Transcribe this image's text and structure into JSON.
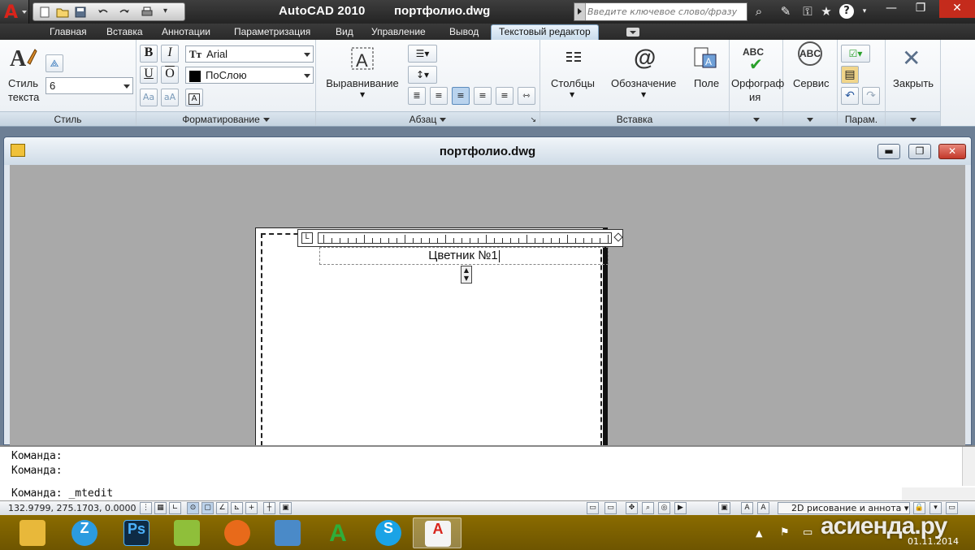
{
  "title": {
    "app": "AutoCAD 2010",
    "file": "портфолио.dwg"
  },
  "search": {
    "placeholder": "Введите ключевое слово/фразу"
  },
  "tabs": [
    {
      "label": "Главная"
    },
    {
      "label": "Вставка"
    },
    {
      "label": "Аннотации"
    },
    {
      "label": "Параметризация"
    },
    {
      "label": "Вид"
    },
    {
      "label": "Управление"
    },
    {
      "label": "Вывод"
    },
    {
      "label": "Текстовый редактор"
    }
  ],
  "ribbon": {
    "style": {
      "title": "Стиль",
      "button_label_1": "Стиль",
      "button_label_2": "текста",
      "height_value": "6"
    },
    "format": {
      "title": "Форматирование",
      "bold": "B",
      "italic": "I",
      "underline": "U",
      "overline": "O",
      "font_value": "Arial",
      "color_value": "ПоСлою",
      "case_upper": "Aa",
      "case_lower": "aA"
    },
    "paragraph": {
      "title": "Абзац",
      "justify_label": "Выравнивание"
    },
    "insert": {
      "title": "Вставка",
      "columns": "Столбцы",
      "symbol": "Обозначение",
      "field": "Поле"
    },
    "spell": {
      "label_1": "Орфограф",
      "label_2": "ия",
      "icon_text": "ABC"
    },
    "tools": {
      "label": "Сервис",
      "icon_text": "ABC"
    },
    "options": {
      "title": "Парам."
    },
    "close": {
      "label": "Закрыть"
    }
  },
  "document": {
    "title": "портфолио.dwg",
    "text": "Цветник №1"
  },
  "command": {
    "line1": "Команда:",
    "line2": "Команда:",
    "prompt": "Команда:  _mtedit"
  },
  "status": {
    "coords": "132.9799, 275.1703, 0.0000",
    "workspace": "2D рисование и аннота"
  },
  "taskbar": {
    "apps": [
      {
        "icon": "folder-icon",
        "color": "#e8b83a"
      },
      {
        "icon": "zoho-icon",
        "color": "#2b9be0",
        "text": "Z"
      },
      {
        "icon": "photoshop-icon",
        "color": "#0e2b45",
        "text": "Ps"
      },
      {
        "icon": "notepad-icon",
        "color": "#8fbf3a"
      },
      {
        "icon": "firefox-icon",
        "color": "#e86a1a"
      },
      {
        "icon": "image-viewer-icon",
        "color": "#4a8ac8"
      },
      {
        "icon": "app-a-icon",
        "color": "#2fae3a",
        "text": "A"
      },
      {
        "icon": "skype-icon",
        "color": "#1aa3e6",
        "text": "S"
      },
      {
        "icon": "autocad-icon",
        "color": "#d8241b"
      }
    ],
    "watermark": "асиенда.ру",
    "date": "01.11.2014"
  },
  "colors": {
    "title_bg": "#2b2b2b",
    "ribbon_bg": "#eef2f6",
    "taskbar": "#7a5e00",
    "autocad_red": "#d8241b"
  }
}
